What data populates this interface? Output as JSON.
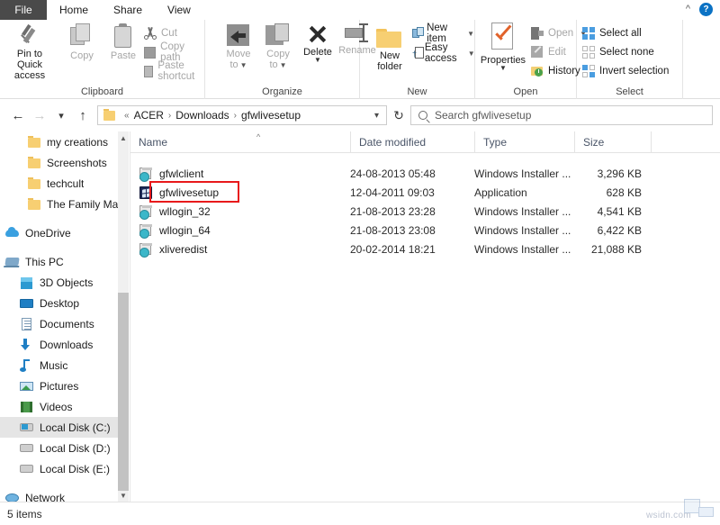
{
  "tabs": [
    {
      "label": "File",
      "name": "tab-file"
    },
    {
      "label": "Home",
      "name": "tab-home"
    },
    {
      "label": "Share",
      "name": "tab-share"
    },
    {
      "label": "View",
      "name": "tab-view"
    }
  ],
  "titlebar": {
    "collapse_icon": "chevron-up-icon",
    "help_label": "?"
  },
  "ribbon": {
    "groups": [
      {
        "title": "Clipboard"
      },
      {
        "title": "Organize"
      },
      {
        "title": "New"
      },
      {
        "title": "Open"
      },
      {
        "title": "Select"
      }
    ],
    "clipboard": {
      "pin_label_line1": "Pin to Quick",
      "pin_label_line2": "access",
      "copy_label": "Copy",
      "paste_label": "Paste",
      "cut_label": "Cut",
      "copy_path_label": "Copy path",
      "paste_shortcut_label": "Paste shortcut"
    },
    "organize": {
      "move_to_line1": "Move",
      "move_to_line2": "to",
      "copy_to_line1": "Copy",
      "copy_to_line2": "to",
      "delete_label": "Delete",
      "rename_label": "Rename"
    },
    "new": {
      "new_folder_line1": "New",
      "new_folder_line2": "folder",
      "new_item_label": "New item",
      "easy_access_label": "Easy access"
    },
    "open": {
      "properties_label": "Properties",
      "open_label": "Open",
      "edit_label": "Edit",
      "history_label": "History"
    },
    "select": {
      "select_all_label": "Select all",
      "select_none_label": "Select none",
      "invert_selection_label": "Invert selection"
    }
  },
  "navbar": {
    "back_icon": "arrow-left-icon",
    "forward_icon": "arrow-right-icon",
    "recent_icon": "chevron-down-icon",
    "up_icon": "arrow-up-icon",
    "breadcrumb_overflow": "«",
    "breadcrumbs": [
      "ACER",
      "Downloads",
      "gfwlivesetup"
    ],
    "breadcrumb_separator": "›",
    "dropdown_icon": "chevron-down-icon",
    "refresh_icon": "refresh-icon",
    "refresh_glyph": "↻"
  },
  "search": {
    "placeholder": "Search gfwlivesetup",
    "icon": "search-icon"
  },
  "sidebar": {
    "items": [
      {
        "label": "my creations",
        "icon": "folder-icon",
        "indent": 2,
        "selected": false
      },
      {
        "label": "Screenshots",
        "icon": "folder-icon",
        "indent": 2,
        "selected": false
      },
      {
        "label": "techcult",
        "icon": "folder-icon",
        "indent": 2,
        "selected": false
      },
      {
        "label": "The Family Man S",
        "icon": "folder-icon",
        "indent": 2,
        "selected": false
      },
      {
        "label": "OneDrive",
        "icon": "onedrive-cloud-icon",
        "indent": 0,
        "selected": false
      },
      {
        "label": "This PC",
        "icon": "this-pc-icon",
        "indent": 0,
        "selected": false
      },
      {
        "label": "3D Objects",
        "icon": "3d-objects-icon",
        "indent": 1,
        "selected": false
      },
      {
        "label": "Desktop",
        "icon": "desktop-icon",
        "indent": 1,
        "selected": false
      },
      {
        "label": "Documents",
        "icon": "documents-icon",
        "indent": 1,
        "selected": false
      },
      {
        "label": "Downloads",
        "icon": "downloads-icon",
        "indent": 1,
        "selected": false
      },
      {
        "label": "Music",
        "icon": "music-icon",
        "indent": 1,
        "selected": false
      },
      {
        "label": "Pictures",
        "icon": "pictures-icon",
        "indent": 1,
        "selected": false
      },
      {
        "label": "Videos",
        "icon": "videos-icon",
        "indent": 1,
        "selected": false
      },
      {
        "label": "Local Disk (C:)",
        "icon": "disk-system-icon",
        "indent": 1,
        "selected": true
      },
      {
        "label": "Local Disk (D:)",
        "icon": "disk-icon",
        "indent": 1,
        "selected": false
      },
      {
        "label": "Local Disk (E:)",
        "icon": "disk-icon",
        "indent": 1,
        "selected": false
      },
      {
        "label": "Network",
        "icon": "network-icon",
        "indent": 0,
        "selected": false
      }
    ],
    "scroll_up_icon": "chevron-up-icon",
    "scroll_down_icon": "chevron-down-icon"
  },
  "filelist": {
    "columns": [
      {
        "label": "Name",
        "key": "name"
      },
      {
        "label": "Date modified",
        "key": "date"
      },
      {
        "label": "Type",
        "key": "type"
      },
      {
        "label": "Size",
        "key": "size"
      }
    ],
    "sort_indicator": "^",
    "rows": [
      {
        "name": "gfwlclient",
        "date": "24-08-2013 05:48",
        "type": "Windows Installer ...",
        "size": "3,296 KB",
        "icon": "msi-icon",
        "highlighted": false
      },
      {
        "name": "gfwlivesetup",
        "date": "12-04-2011 09:03",
        "type": "Application",
        "size": "628 KB",
        "icon": "application-icon",
        "highlighted": true
      },
      {
        "name": "wllogin_32",
        "date": "21-08-2013 23:28",
        "type": "Windows Installer ...",
        "size": "4,541 KB",
        "icon": "msi-icon",
        "highlighted": false
      },
      {
        "name": "wllogin_64",
        "date": "21-08-2013 23:08",
        "type": "Windows Installer ...",
        "size": "6,422 KB",
        "icon": "msi-icon",
        "highlighted": false
      },
      {
        "name": "xliveredist",
        "date": "20-02-2014 18:21",
        "type": "Windows Installer ...",
        "size": "21,088 KB",
        "icon": "msi-icon",
        "highlighted": false
      }
    ],
    "highlight_color": "#e8191b"
  },
  "statusbar": {
    "item_count": "5 items"
  },
  "watermark": {
    "text": "wsidn.com"
  }
}
